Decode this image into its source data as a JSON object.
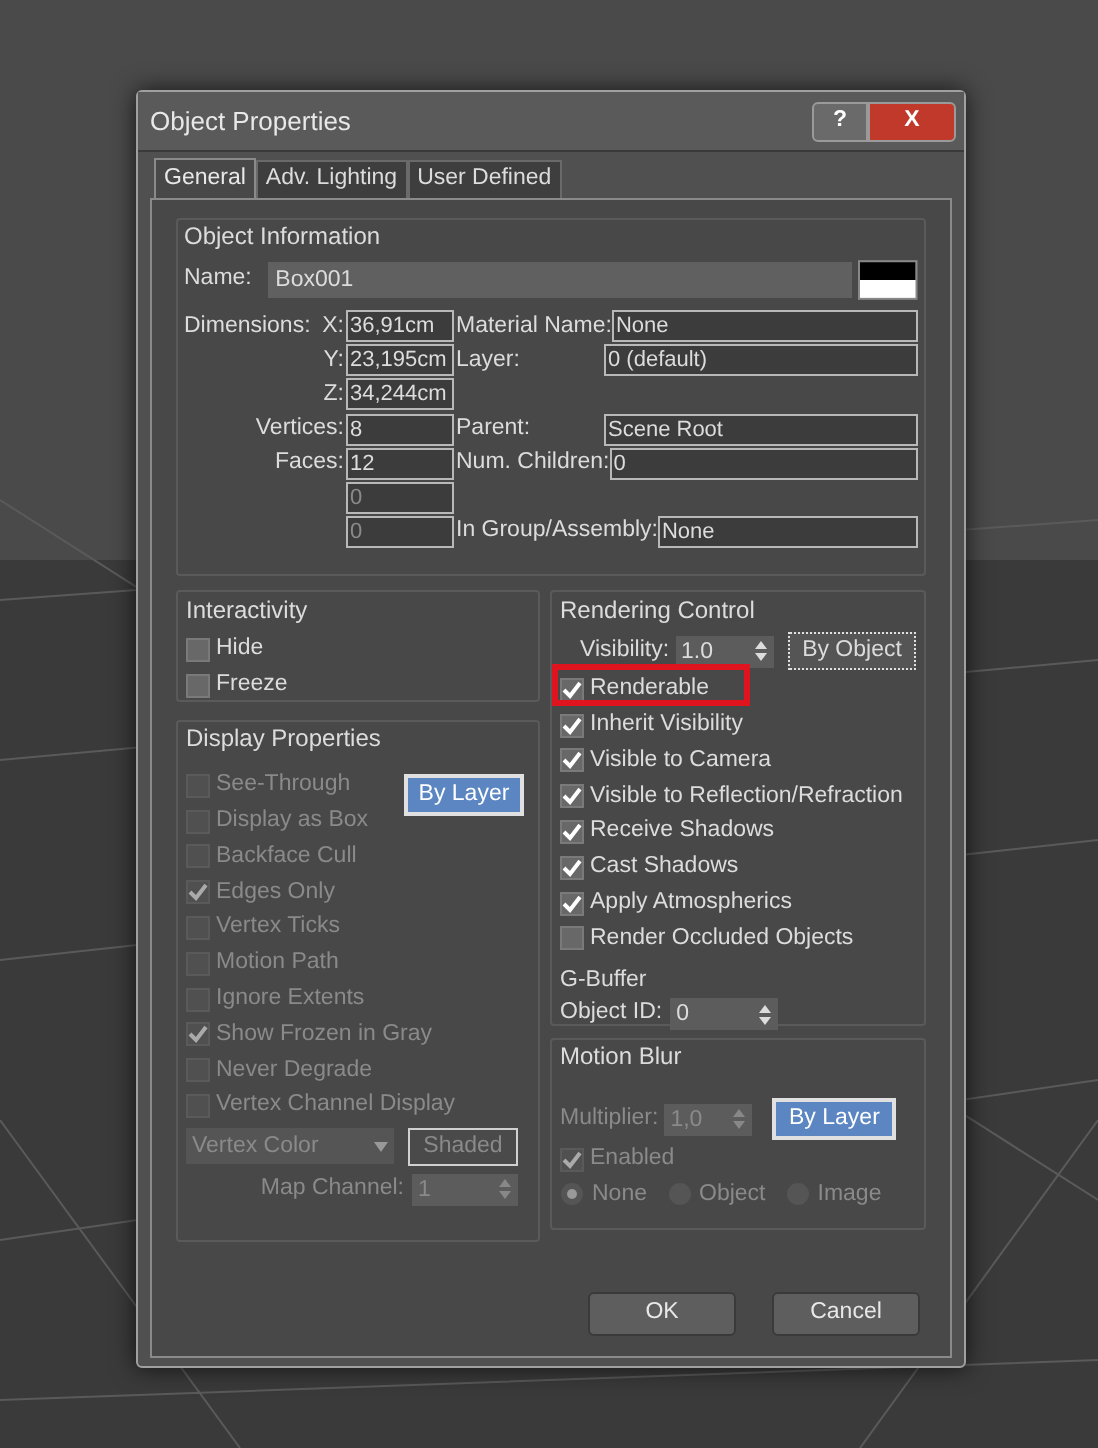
{
  "window": {
    "title": "Object Properties",
    "buttons": [
      "?",
      "X"
    ]
  },
  "tabs": [
    {
      "label": "General",
      "selected": true
    },
    {
      "label": "Adv. Lighting",
      "selected": false
    },
    {
      "label": "User Defined",
      "selected": false
    }
  ],
  "object_information": {
    "title": "Object Information",
    "name_label": "Name:",
    "name": "Box001",
    "dimensions_label": "Dimensions:",
    "rows": [
      {
        "label": "X:",
        "value": "36,91cm",
        "disabled": false,
        "right_label": "Material Name:",
        "right_value": "None"
      },
      {
        "label": "Y:",
        "value": "23,195cm",
        "disabled": false,
        "right_label": "Layer:",
        "right_value": "0 (default)"
      },
      {
        "label": "Z:",
        "value": "34,244cm",
        "disabled": false
      },
      {
        "label": "Vertices:",
        "value": "8",
        "disabled": false,
        "right_label": "Parent:",
        "right_value": "Scene Root"
      },
      {
        "label": "Faces:",
        "value": "12",
        "disabled": false,
        "right_label": "Num. Children:",
        "right_value": "0"
      },
      {
        "value": "0",
        "disabled": true
      },
      {
        "value": "0",
        "disabled": true,
        "right_label": "In Group/Assembly:",
        "right_value": "None"
      }
    ]
  },
  "interactivity": {
    "title": "Interactivity",
    "checkboxes": [
      {
        "label": "Hide",
        "checked": false,
        "disabled": false
      },
      {
        "label": "Freeze",
        "checked": false,
        "disabled": false
      }
    ]
  },
  "display_properties": {
    "title": "Display Properties",
    "by_layer_button": "By Layer",
    "checkboxes": [
      {
        "label": "See-Through",
        "checked": false,
        "disabled": true
      },
      {
        "label": "Display as Box",
        "checked": false,
        "disabled": true
      },
      {
        "label": "Backface Cull",
        "checked": false,
        "disabled": true
      },
      {
        "label": "Edges Only",
        "checked": true,
        "disabled": true
      },
      {
        "label": "Vertex Ticks",
        "checked": false,
        "disabled": true
      },
      {
        "label": "Motion Path",
        "checked": false,
        "disabled": true
      },
      {
        "label": "Ignore Extents",
        "checked": false,
        "disabled": true
      },
      {
        "label": "Show Frozen in Gray",
        "checked": true,
        "disabled": true
      },
      {
        "label": "Never Degrade",
        "checked": false,
        "disabled": true
      },
      {
        "label": "Vertex Channel Display",
        "checked": false,
        "disabled": true
      }
    ],
    "dropdown": {
      "value": "Vertex Color",
      "disabled": true
    },
    "shaded_button": "Shaded",
    "map_channel": {
      "label": "Map Channel:",
      "value": "1",
      "disabled": true
    }
  },
  "rendering_control": {
    "title": "Rendering Control",
    "visibility": {
      "label": "Visibility:",
      "value": "1.0"
    },
    "by_object_button": "By Object",
    "checkboxes": [
      {
        "label": "Renderable",
        "checked": true,
        "highlighted": true
      },
      {
        "label": "Inherit Visibility",
        "checked": true,
        "highlighted": false
      },
      {
        "label": "Visible to Camera",
        "checked": true,
        "highlighted": false
      },
      {
        "label": "Visible to Reflection/Refraction",
        "checked": true,
        "highlighted": false
      },
      {
        "label": "Receive Shadows",
        "checked": true,
        "highlighted": false
      },
      {
        "label": "Cast Shadows",
        "checked": true,
        "highlighted": false
      },
      {
        "label": "Apply Atmospherics",
        "checked": true,
        "highlighted": false
      },
      {
        "label": "Render Occluded Objects",
        "checked": false,
        "highlighted": false
      }
    ]
  },
  "g_buffer": {
    "title": "G-Buffer",
    "object_id": {
      "label": "Object ID:",
      "value": "0"
    }
  },
  "motion_blur": {
    "title": "Motion Blur",
    "multiplier": {
      "label": "Multiplier:",
      "value": "1,0",
      "disabled": true
    },
    "by_layer_button": "By Layer",
    "enabled": {
      "label": "Enabled",
      "checked": true,
      "disabled": true
    },
    "radios": [
      {
        "label": "None",
        "selected": true,
        "disabled": true
      },
      {
        "label": "Object",
        "selected": false,
        "disabled": true
      },
      {
        "label": "Image",
        "selected": false,
        "disabled": true
      }
    ]
  },
  "buttons": [
    "OK",
    "Cancel"
  ]
}
